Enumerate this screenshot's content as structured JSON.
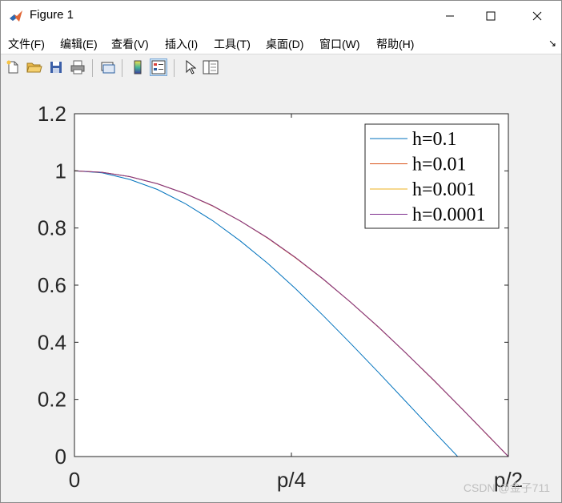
{
  "window": {
    "title": "Figure 1"
  },
  "menu": {
    "items": [
      "文件(F)",
      "编辑(E)",
      "查看(V)",
      "插入(I)",
      "工具(T)",
      "桌面(D)",
      "窗口(W)",
      "帮助(H)"
    ]
  },
  "toolbar": {
    "buttons": [
      "new-figure-icon",
      "open-file-icon",
      "save-icon",
      "print-icon",
      "link-plot-icon",
      "colorbar-icon",
      "legend-icon",
      "pointer-icon",
      "property-editor-icon"
    ]
  },
  "chart_data": {
    "type": "line",
    "title": "",
    "xlabel": "",
    "ylabel": "",
    "xlim": [
      0,
      1.5708
    ],
    "ylim": [
      0,
      1.2
    ],
    "xticks": [
      0,
      0.7854,
      1.5708
    ],
    "xtick_labels": [
      "0",
      "p/4",
      "p/2"
    ],
    "yticks": [
      0,
      0.2,
      0.4,
      0.6,
      0.8,
      1,
      1.2
    ],
    "ytick_labels": [
      "0",
      "0.2",
      "0.4",
      "0.6",
      "0.8",
      "1",
      "1.2"
    ],
    "grid": false,
    "legend_position": "top-right",
    "series": [
      {
        "name": "h=0.1",
        "color": "#0072BD",
        "x": [
          0,
          0.1,
          0.2,
          0.3,
          0.4,
          0.5,
          0.6,
          0.7,
          0.8,
          0.9,
          1.0,
          1.1,
          1.2,
          1.3,
          1.4,
          1.5,
          1.5708
        ],
        "y": [
          1,
          0.993,
          0.97,
          0.935,
          0.886,
          0.826,
          0.755,
          0.676,
          0.588,
          0.494,
          0.396,
          0.295,
          0.192,
          0.089,
          -0.013,
          -0.12,
          -0.2
        ]
      },
      {
        "name": "h=0.01",
        "color": "#D95319",
        "x": [
          0,
          0.1,
          0.2,
          0.3,
          0.4,
          0.5,
          0.6,
          0.7,
          0.8,
          0.9,
          1.0,
          1.1,
          1.2,
          1.3,
          1.4,
          1.5,
          1.5708
        ],
        "y": [
          1,
          0.995,
          0.98,
          0.955,
          0.921,
          0.877,
          0.825,
          0.764,
          0.696,
          0.621,
          0.54,
          0.453,
          0.362,
          0.267,
          0.17,
          0.07,
          0.0
        ]
      },
      {
        "name": "h=0.001",
        "color": "#EDB120",
        "x": [
          0,
          0.1,
          0.2,
          0.3,
          0.4,
          0.5,
          0.6,
          0.7,
          0.8,
          0.9,
          1.0,
          1.1,
          1.2,
          1.3,
          1.4,
          1.5,
          1.5708
        ],
        "y": [
          1,
          0.995,
          0.98,
          0.955,
          0.921,
          0.878,
          0.825,
          0.765,
          0.697,
          0.622,
          0.54,
          0.454,
          0.362,
          0.268,
          0.17,
          0.071,
          0.0
        ]
      },
      {
        "name": "h=0.0001",
        "color": "#7E2F8E",
        "x": [
          0,
          0.1,
          0.2,
          0.3,
          0.4,
          0.5,
          0.6,
          0.7,
          0.8,
          0.9,
          1.0,
          1.1,
          1.2,
          1.3,
          1.4,
          1.5,
          1.5708
        ],
        "y": [
          1,
          0.995,
          0.98,
          0.955,
          0.921,
          0.878,
          0.825,
          0.765,
          0.697,
          0.622,
          0.54,
          0.454,
          0.362,
          0.268,
          0.17,
          0.071,
          0.0
        ]
      }
    ]
  },
  "watermark": "CSDN @金子711"
}
